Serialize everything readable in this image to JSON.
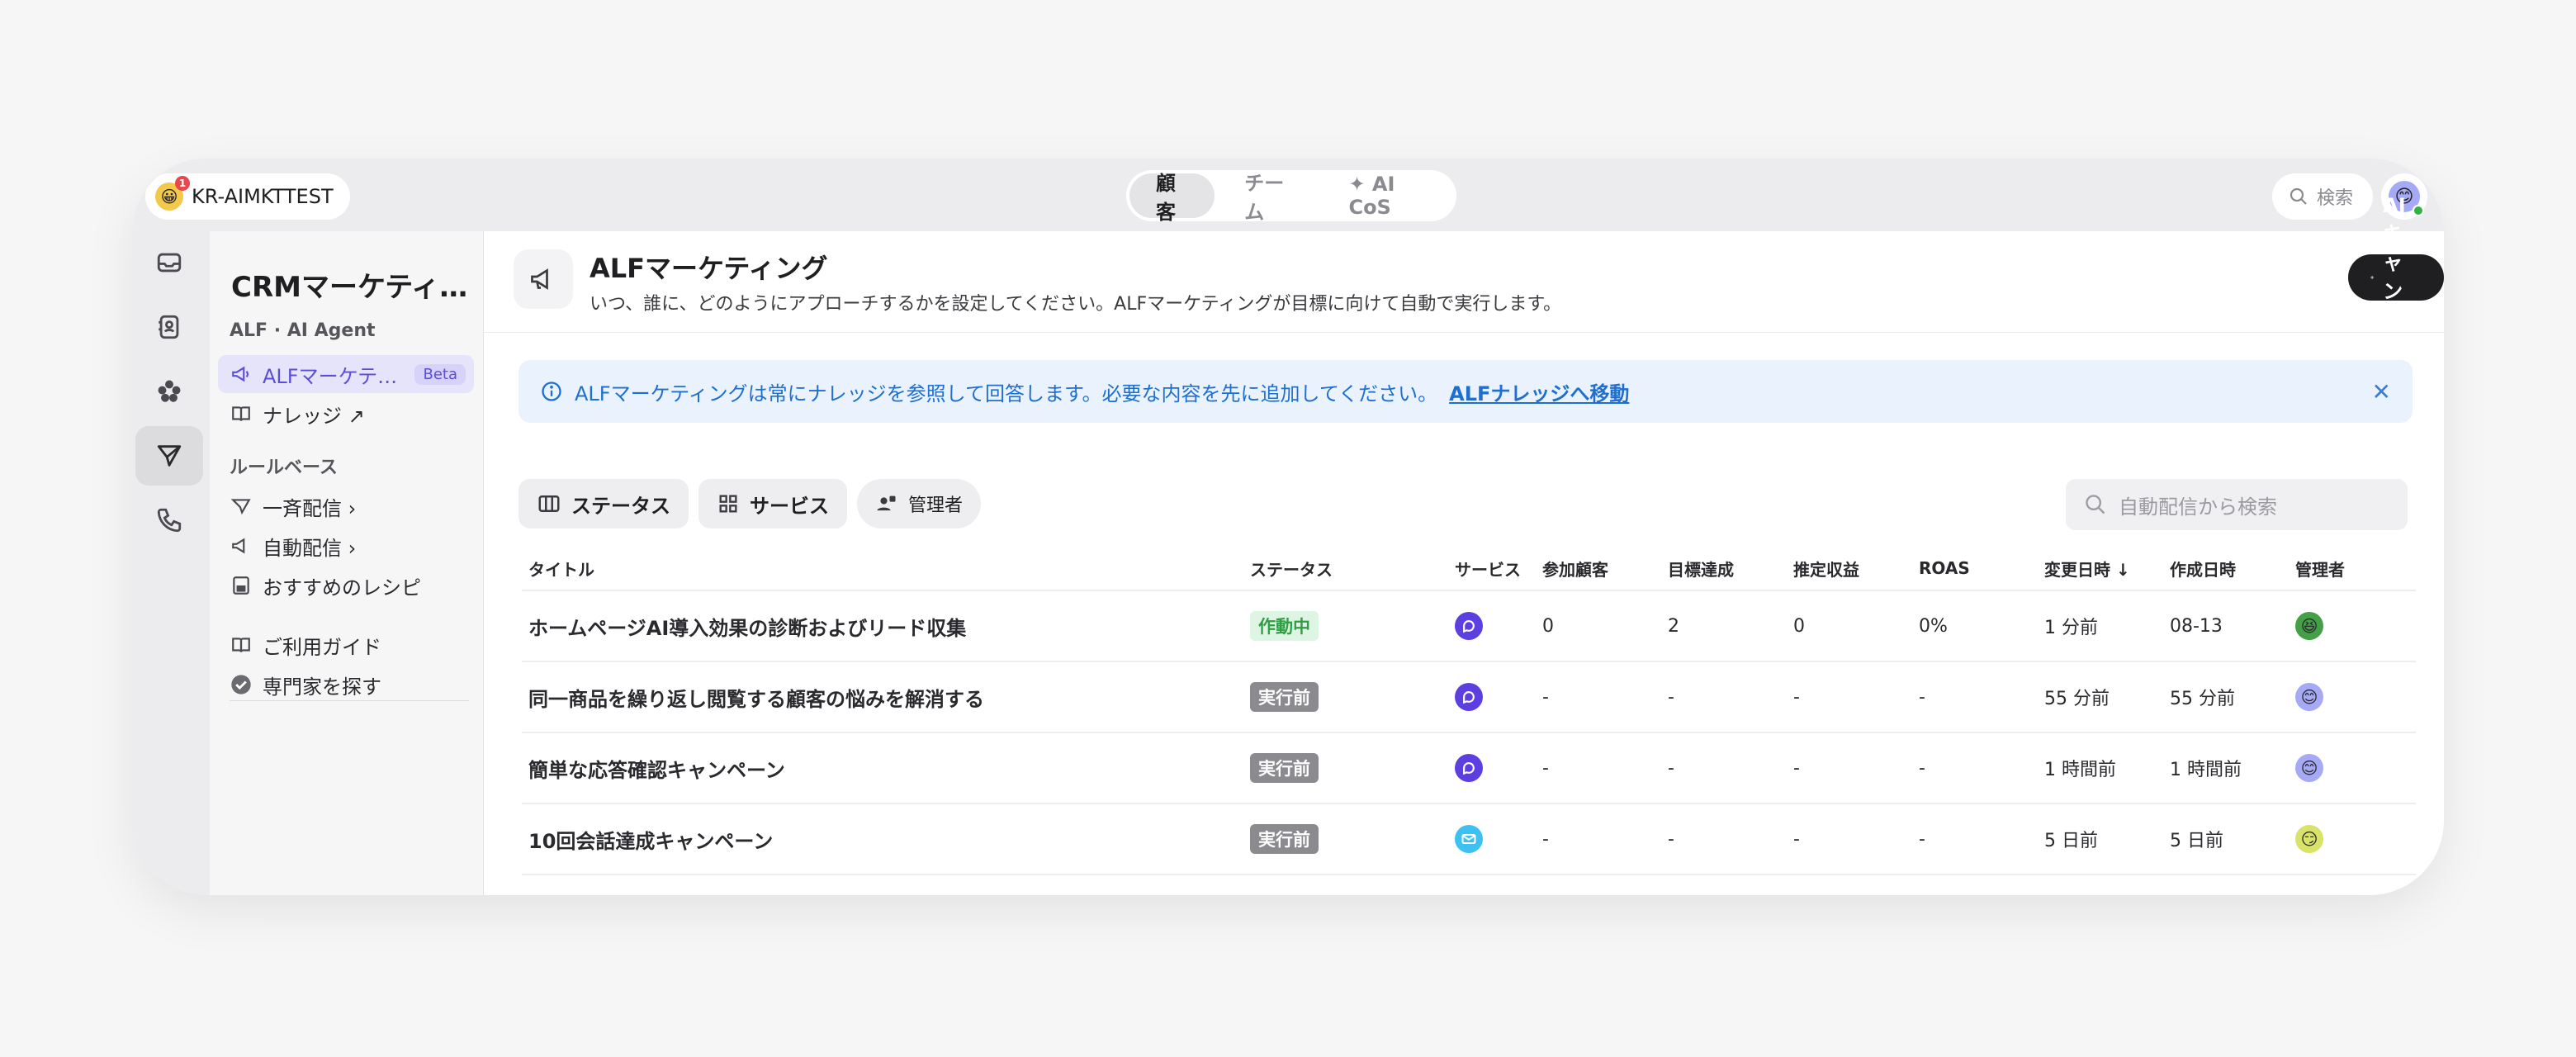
{
  "workspace": {
    "name": "KR-AIMKTTEST",
    "badge": "1"
  },
  "top_tabs": [
    {
      "label": "顧客",
      "active": true
    },
    {
      "label": "チーム",
      "active": false
    },
    {
      "label": "✦ AI CoS",
      "active": false
    }
  ],
  "top_search": {
    "label": "検索"
  },
  "sidebar": {
    "title": "CRMマーケティ…",
    "section_alf": "ALF · AI Agent",
    "alf_item": {
      "label": "ALFマーケテ…",
      "badge": "Beta"
    },
    "knowledge": {
      "label": "ナレッジ ↗"
    },
    "section_rule": "ルールベース",
    "items": [
      {
        "label": "一斉配信 ›"
      },
      {
        "label": "自動配信 ›"
      },
      {
        "label": "おすすめのレシピ"
      }
    ],
    "guide": "ご利用ガイド",
    "expert": "専門家を探す"
  },
  "header": {
    "title": "ALFマーケティング",
    "description": "いつ、誰に、どのようにアプローチするかを設定してください。ALFマーケティングが目標に向けて自動で実行します。",
    "ai_button": "AIキャンペーン"
  },
  "banner": {
    "text": "ALFマーケティングは常にナレッジを参照して回答します。必要な内容を先に追加してください。",
    "link": "ALFナレッジへ移動"
  },
  "filters": {
    "status": "ステータス",
    "service": "サービス",
    "manager": "管理者"
  },
  "table_search": {
    "placeholder": "自動配信から検索"
  },
  "table": {
    "columns": [
      "タイトル",
      "ステータス",
      "サービス",
      "参加顧客",
      "目標達成",
      "推定収益",
      "ROAS",
      "変更日時 ↓",
      "作成日時",
      "管理者"
    ],
    "rows": [
      {
        "title": "ホームページAI導入効果の診断およびリード収集",
        "status": "作動中",
        "status_kind": "running",
        "service": "chat",
        "participants": "0",
        "goal": "2",
        "revenue": "0",
        "roas": "0%",
        "updated": "1 分前",
        "created": "08-13",
        "manager_color": "#43a047"
      },
      {
        "title": "同一商品を繰り返し閲覧する顧客の悩みを解消する",
        "status": "実行前",
        "status_kind": "pending",
        "service": "chat",
        "participants": "-",
        "goal": "-",
        "revenue": "-",
        "roas": "-",
        "updated": "55 分前",
        "created": "55 分前",
        "manager_color": "#a6a9f5"
      },
      {
        "title": "簡単な応答確認キャンペーン",
        "status": "実行前",
        "status_kind": "pending",
        "service": "chat",
        "participants": "-",
        "goal": "-",
        "revenue": "-",
        "roas": "-",
        "updated": "1 時間前",
        "created": "1 時間前",
        "manager_color": "#a6a9f5"
      },
      {
        "title": "10回会話達成キャンペーン",
        "status": "実行前",
        "status_kind": "pending",
        "service": "email",
        "participants": "-",
        "goal": "-",
        "revenue": "-",
        "roas": "-",
        "updated": "5 日前",
        "created": "5 日前",
        "manager_color": "#d9e36a"
      }
    ]
  },
  "colors": {
    "accent": "#5b4fd6",
    "info": "#1f6fd1",
    "chat_service": "#5b3fe0",
    "email_service": "#3ec1f0"
  }
}
